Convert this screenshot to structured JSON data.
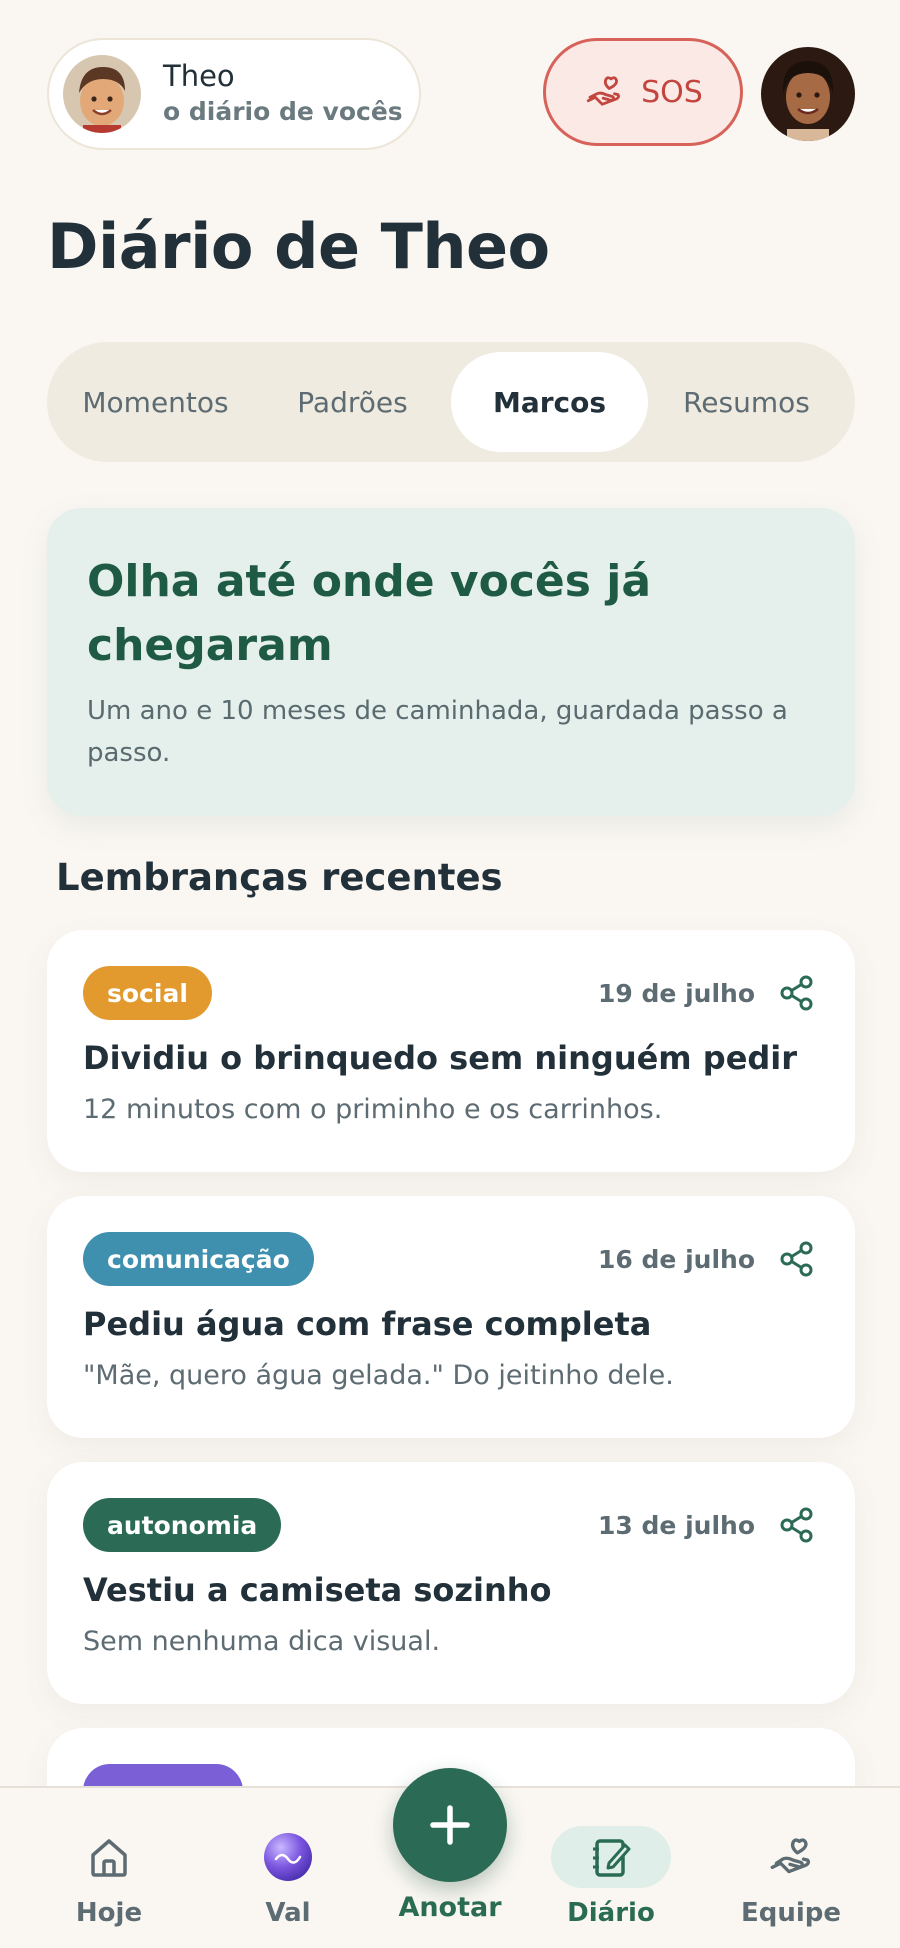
{
  "header": {
    "child_name": "Theo",
    "child_subtitle": "o diário de vocês",
    "sos_label": "SOS"
  },
  "page": {
    "title": "Diário de Theo"
  },
  "tabs": [
    {
      "label": "Momentos",
      "active": false
    },
    {
      "label": "Padrões",
      "active": false
    },
    {
      "label": "Marcos",
      "active": true
    },
    {
      "label": "Resumos",
      "active": false
    }
  ],
  "hero": {
    "title": "Olha até onde vocês já chegaram",
    "subtitle": "Um ano e 10 meses de caminhada, guardada passo a passo."
  },
  "section": {
    "title": "Lembranças recentes"
  },
  "memories": [
    {
      "tag": "social",
      "tag_color": "#e29a2f",
      "date": "19 de julho",
      "title": "Dividiu o brinquedo sem ninguém pedir",
      "description": "12 minutos com o priminho e os carrinhos."
    },
    {
      "tag": "comunicação",
      "tag_color": "#3f8fae",
      "date": "16 de julho",
      "title": "Pediu água com frase completa",
      "description": "\"Mãe, quero água gelada.\" Do jeitinho dele."
    },
    {
      "tag": "autonomia",
      "tag_color": "#2b6b55",
      "date": "13 de julho",
      "title": "Vestiu a camiseta sozinho",
      "description": "Sem nenhuma dica visual."
    }
  ],
  "nav": {
    "items": [
      {
        "label": "Hoje",
        "icon": "home-icon"
      },
      {
        "label": "Val",
        "icon": "val-orb-icon"
      },
      {
        "label": "Diário",
        "icon": "journal-icon",
        "active": true
      },
      {
        "label": "Equipe",
        "icon": "team-hand-icon"
      }
    ],
    "fab_label": "Anotar"
  },
  "colors": {
    "accent": "#2b6b55",
    "sos": "#d7625a",
    "hero_bg": "#e5f0ec",
    "background": "#faf7f2"
  }
}
